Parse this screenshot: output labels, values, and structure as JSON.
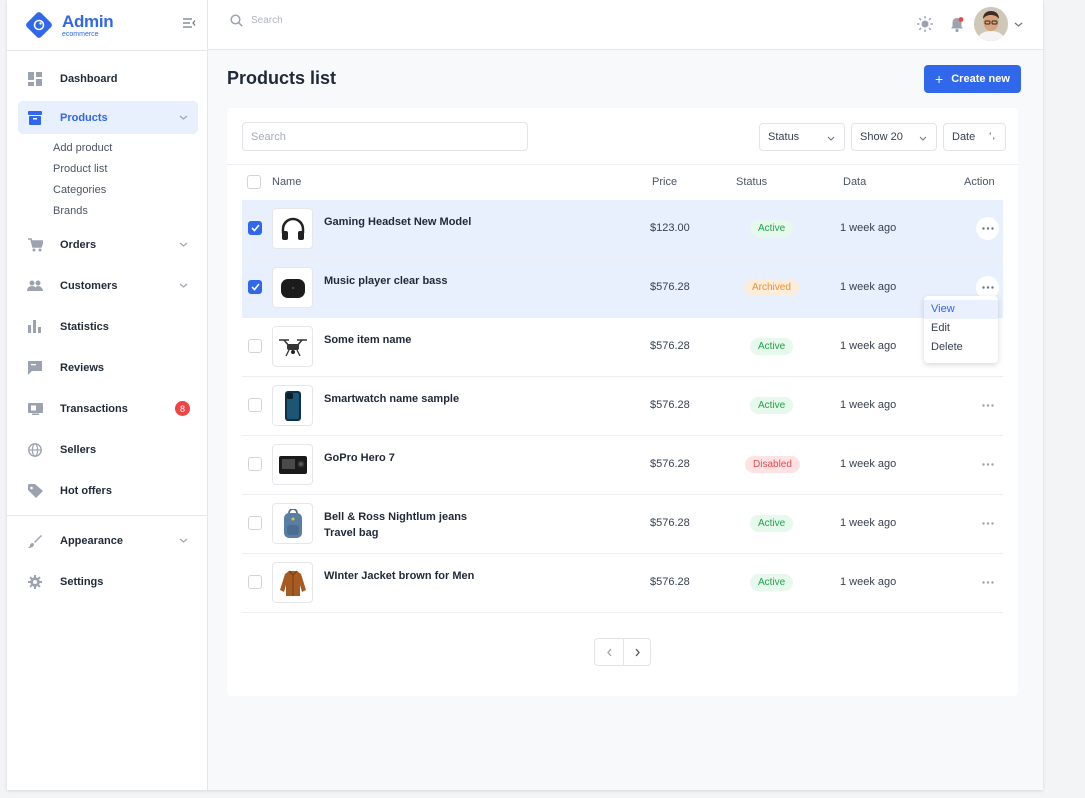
{
  "brand": {
    "name": "Admin",
    "subtitle": "ecommerce"
  },
  "sidebar": {
    "items": [
      {
        "label": "Dashboard",
        "icon": "dashboard-icon"
      },
      {
        "label": "Products",
        "icon": "archive-icon",
        "active": true,
        "expanded": true
      },
      {
        "label": "Orders",
        "icon": "cart-icon"
      },
      {
        "label": "Customers",
        "icon": "people-icon"
      },
      {
        "label": "Statistics",
        "icon": "bar-chart-icon"
      },
      {
        "label": "Reviews",
        "icon": "comment-icon"
      },
      {
        "label": "Transactions",
        "icon": "monitor-icon",
        "badge": "8"
      },
      {
        "label": "Sellers",
        "icon": "globe-icon"
      },
      {
        "label": "Hot offers",
        "icon": "tag-icon"
      },
      {
        "label": "Appearance",
        "icon": "brush-icon"
      },
      {
        "label": "Settings",
        "icon": "gear-icon"
      }
    ],
    "products_sub": [
      "Add product",
      "Product list",
      "Categories",
      "Brands"
    ]
  },
  "header": {
    "search_placeholder": "Search"
  },
  "page": {
    "title": "Products list",
    "create_label": "Create new"
  },
  "filters": {
    "search_placeholder": "Search",
    "status": "Status",
    "show": "Show 20",
    "date": "Date"
  },
  "table": {
    "columns": [
      "Name",
      "Price",
      "Status",
      "Data",
      "Action"
    ],
    "rows": [
      {
        "name": "Gaming Headset New Model",
        "price": "$123.00",
        "status": "Active",
        "date": "1 week ago",
        "checked": true,
        "thumb": "headset"
      },
      {
        "name": "Music player clear bass",
        "price": "$576.28",
        "status": "Archived",
        "date": "1 week ago",
        "checked": true,
        "thumb": "speaker"
      },
      {
        "name": "Some item name",
        "price": "$576.28",
        "status": "Active",
        "date": "1 week ago",
        "checked": false,
        "thumb": "drone"
      },
      {
        "name": "Smartwatch name sample",
        "price": "$576.28",
        "status": "Active",
        "date": "1 week ago",
        "checked": false,
        "thumb": "phone"
      },
      {
        "name": "GoPro Hero 7",
        "price": "$576.28",
        "status": "Disabled",
        "date": "1 week ago",
        "checked": false,
        "thumb": "camera"
      },
      {
        "name": "Bell & Ross Nightlum jeans Travel bag",
        "price": "$576.28",
        "status": "Active",
        "date": "1 week ago",
        "checked": false,
        "thumb": "backpack"
      },
      {
        "name": "WInter Jacket brown for Men",
        "price": "$576.28",
        "status": "Active",
        "date": "1 week ago",
        "checked": false,
        "thumb": "jacket"
      }
    ]
  },
  "action_menu": [
    "View",
    "Edit",
    "Delete"
  ],
  "colors": {
    "primary": "#3167eb",
    "active": "#20a34a",
    "archived": "#e8923a",
    "disabled": "#e14b4b"
  }
}
